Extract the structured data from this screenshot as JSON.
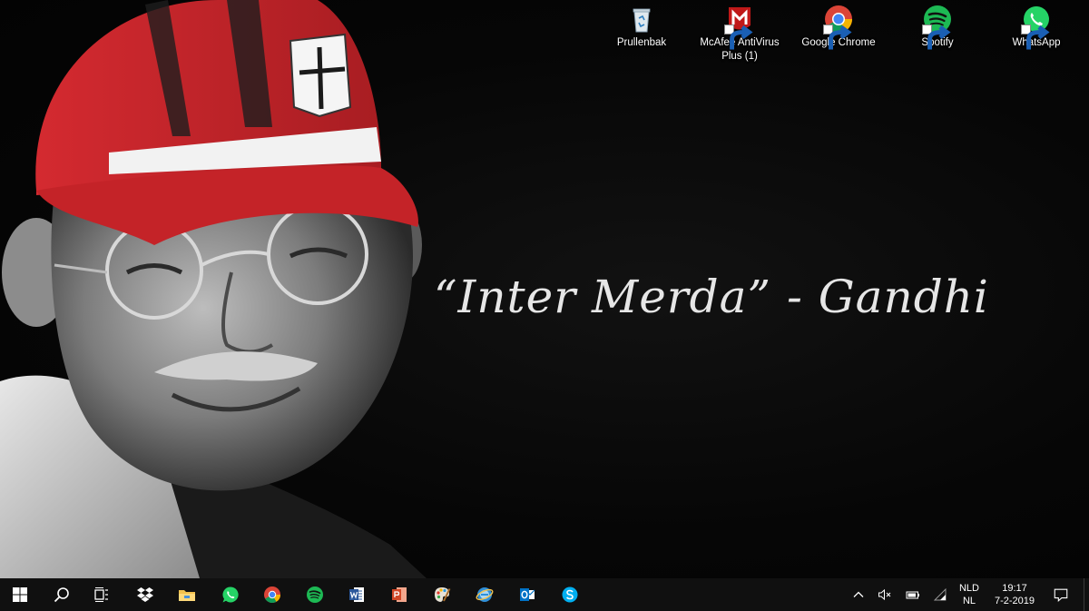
{
  "desktop": {
    "wallpaper_quote": "“Inter Merda” - Gandhi",
    "icons": [
      {
        "label": "Prullenbak",
        "icon": "recycle-bin-icon"
      },
      {
        "label": "McAfee AntiVirus Plus (1)",
        "icon": "mcafee-icon"
      },
      {
        "label": "Google Chrome",
        "icon": "chrome-icon"
      },
      {
        "label": "Spotify",
        "icon": "spotify-icon"
      },
      {
        "label": "WhatsApp",
        "icon": "whatsapp-icon"
      }
    ]
  },
  "taskbar": {
    "pinned": [
      "start-icon",
      "search-icon",
      "task-view-icon",
      "dropbox-icon",
      "file-explorer-icon",
      "whatsapp-icon",
      "chrome-icon",
      "spotify-icon",
      "word-icon",
      "powerpoint-icon",
      "paint-icon",
      "internet-explorer-icon",
      "outlook-icon",
      "skype-icon"
    ],
    "tray": {
      "icons": [
        "chevron-up-icon",
        "volume-muted-icon",
        "battery-icon",
        "wifi-icon"
      ],
      "language_top": "NLD",
      "language_bottom": "NL",
      "time": "19:17",
      "date": "7-2-2019",
      "notification_icon": "action-center-icon"
    }
  },
  "colors": {
    "taskbar_bg": "#101010",
    "cap_red": "#c8262c",
    "spotify_green": "#1db954",
    "whatsapp_green": "#25d366"
  }
}
